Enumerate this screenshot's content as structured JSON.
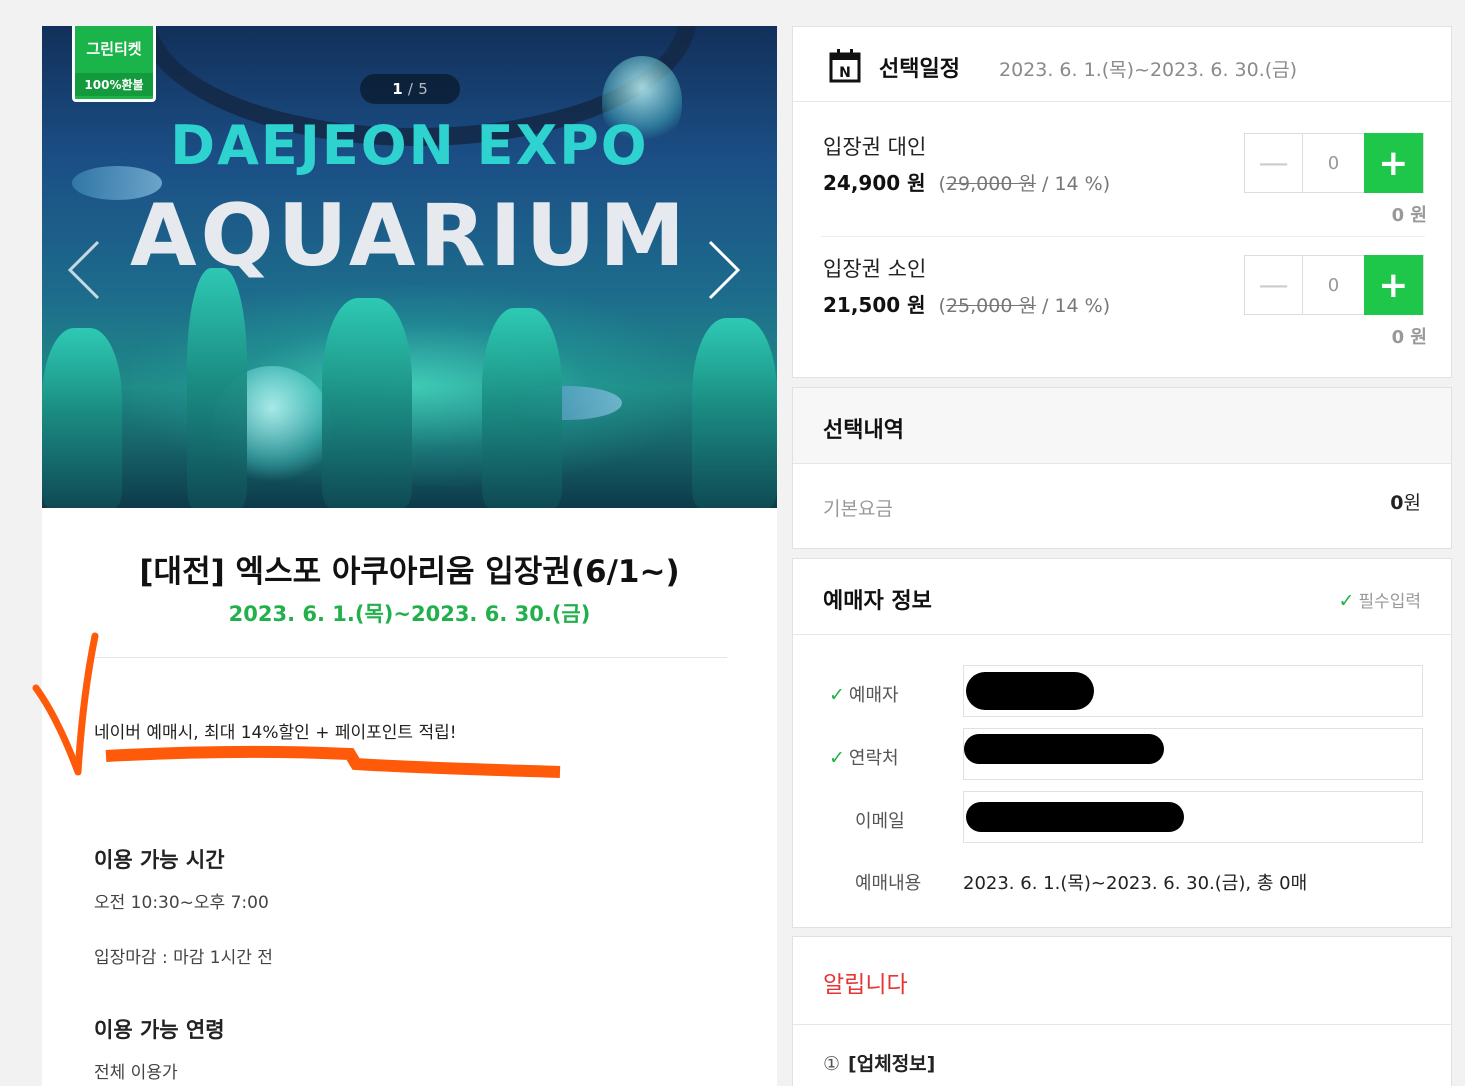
{
  "banner": {
    "badge_top": "그린티켓",
    "badge_bottom": "100%환불",
    "pager_current": "1",
    "pager_sep": "/",
    "pager_total": "5",
    "title_line1": "DAEJEON EXPO",
    "title_line2": "AQUARIUM"
  },
  "product": {
    "title": "[대전] 엑스포 아쿠아리움 입장권(6/1~)",
    "date": "2023. 6. 1.(목)~2023. 6. 30.(금)",
    "promo": "네이버 예매시, 최대 14%할인 + 페이포인트 적립!",
    "hours_heading": "이용 가능 시간",
    "hours": "오전 10:30~오후 7:00",
    "closing": "입장마감 : 마감 1시간 전",
    "age_heading": "이용 가능 연령",
    "age": "전체 이용가"
  },
  "schedule": {
    "icon": "calendar-icon",
    "title": "선택일정",
    "range": "2023. 6. 1.(목)~2023. 6. 30.(금)",
    "tickets": [
      {
        "name": "입장권 대인",
        "price": "24,900 원",
        "orig_open": "(",
        "orig_price": "29,000 원",
        "discount": "/ 14 %",
        "orig_close": ")",
        "qty": "0",
        "subtotal": "0 원"
      },
      {
        "name": "입장권 소인",
        "price": "21,500 원",
        "orig_open": "(",
        "orig_price": "25,000 원",
        "discount": "/ 14 %",
        "orig_close": ")",
        "qty": "0",
        "subtotal": "0 원"
      }
    ]
  },
  "summary": {
    "title": "선택내역",
    "base_label": "기본요금",
    "base_value": "0",
    "base_unit": "원"
  },
  "booker": {
    "title": "예매자 정보",
    "required": "필수입력",
    "check": "✓",
    "name_label": "예매자",
    "phone_label": "연락처",
    "email_label": "이메일",
    "details_label": "예매내용",
    "details_value": "2023. 6. 1.(목)~2023. 6. 30.(금), 총 0매"
  },
  "notice": {
    "title": "알립니다",
    "item_num": "①",
    "item_text": "[업체정보]"
  },
  "colors": {
    "accent_green": "#1ec64a",
    "date_green": "#21b04b",
    "notice_red": "#e53535",
    "annotation_orange": "#ff5a0a"
  }
}
